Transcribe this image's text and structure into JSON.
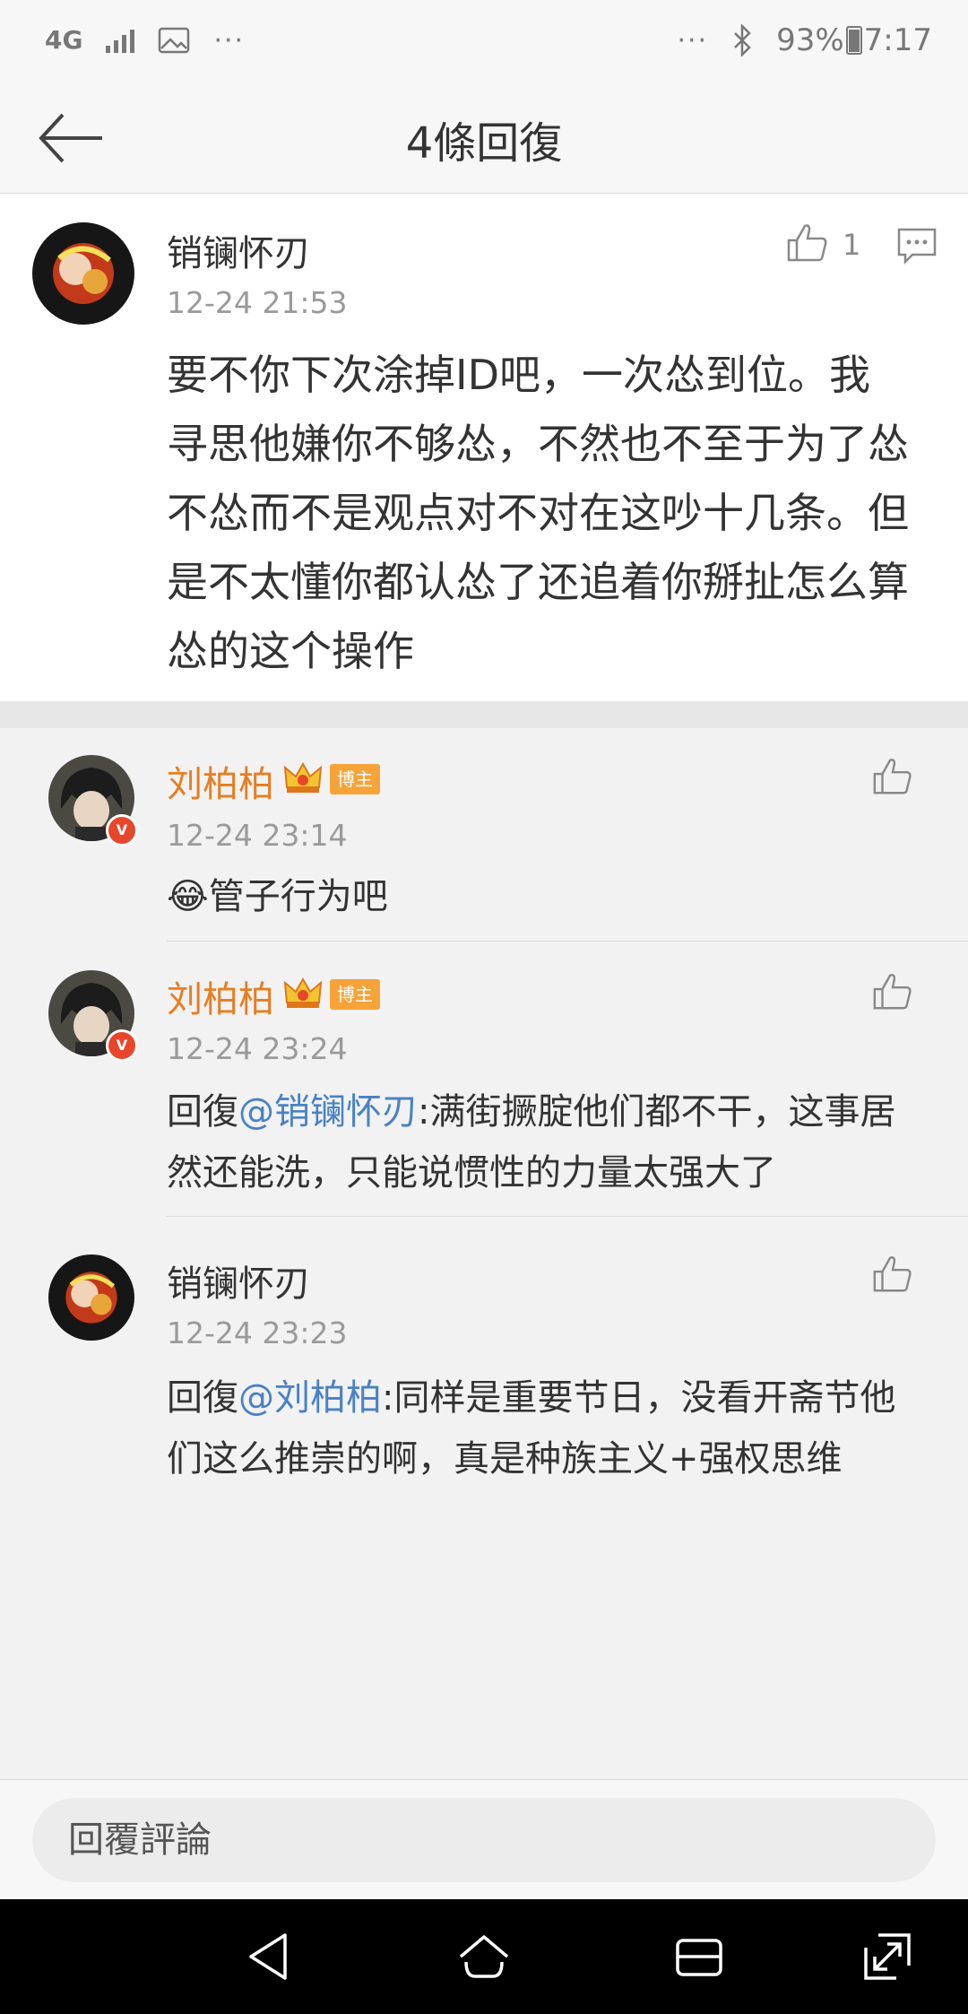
{
  "status_bar": {
    "network": "4G",
    "dots_left": "···",
    "dots_right": "···",
    "battery": "93%",
    "time": "7:17"
  },
  "header": {
    "title": "4條回復",
    "back_icon": "back-arrow-icon"
  },
  "main_comment": {
    "username": "销镧怀刃",
    "timestamp": "12-24 21:53",
    "likes": "1",
    "text": "要不你下次涂掉ID吧，一次怂到位。我寻思他嫌你不够怂，不然也不至于为了怂不怂而不是观点对不对在这吵十几条。但是不太懂你都认怂了还追着你掰扯怎么算怂的这个操作"
  },
  "replies": [
    {
      "username": "刘柏柏",
      "badge": "博主",
      "verified": "V",
      "timestamp": "12-24 23:14",
      "emoji": "😂",
      "text": "管子行为吧"
    },
    {
      "username": "刘柏柏",
      "badge": "博主",
      "verified": "V",
      "timestamp": "12-24 23:24",
      "prefix": "回復",
      "mention": "@销镧怀刃",
      "text": ":满街撅腚他们都不干，这事居然还能洗，只能说惯性的力量太强大了"
    },
    {
      "username": "销镧怀刃",
      "timestamp": "12-24 23:23",
      "prefix": "回復",
      "mention": "@刘柏柏",
      "text": ":同样是重要节日，没看开斋节他们这么推崇的啊，真是种族主义+强权思维"
    }
  ],
  "bottom_bar": {
    "placeholder": "回覆評論"
  },
  "colors": {
    "username_vip": "#e67e22",
    "mention": "#4a82c3",
    "badge": "#f6a33a",
    "verified": "#e8462a"
  }
}
